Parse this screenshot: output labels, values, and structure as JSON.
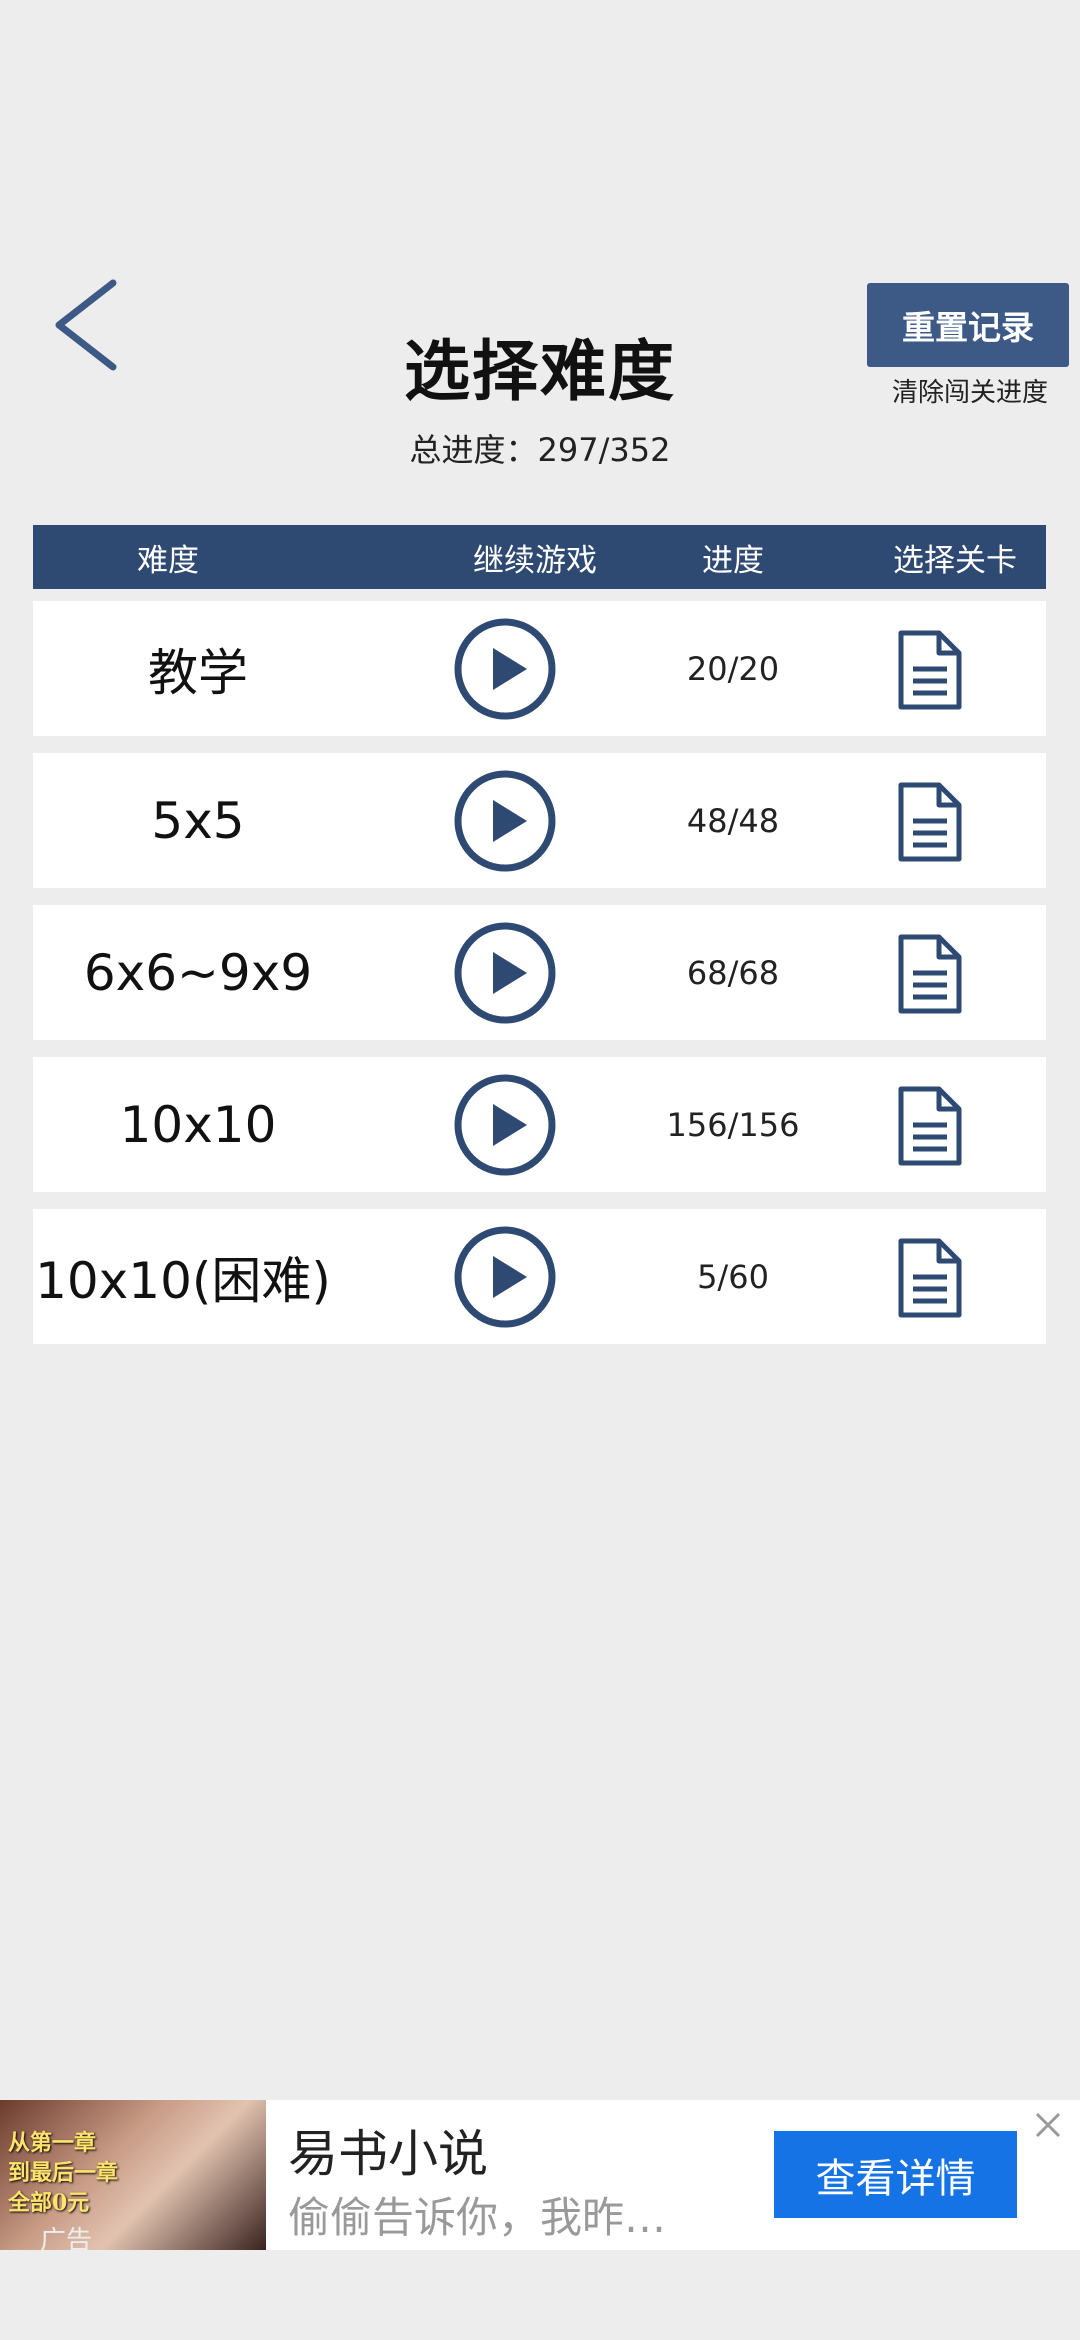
{
  "header": {
    "title": "选择难度",
    "total_progress": "总进度：297/352",
    "reset_button": "重置记录",
    "reset_note": "清除闯关进度",
    "back_icon": "chevron-left-icon"
  },
  "table": {
    "headers": [
      "难度",
      "继续游戏",
      "进度",
      "选择关卡"
    ],
    "rows": [
      {
        "name": "教学",
        "progress": "20/20"
      },
      {
        "name": "5x5",
        "progress": "48/48"
      },
      {
        "name": "6x6~9x9",
        "progress": "68/68"
      },
      {
        "name": "10x10",
        "progress": "156/156"
      },
      {
        "name": "10x10(困难)",
        "progress": "5/60"
      }
    ]
  },
  "ad": {
    "title": "易书小说",
    "subtitle": "偷偷告诉你，我昨…",
    "button": "查看详情",
    "image_text": "从第一章\n到最后一章\n全部0元",
    "label": "广告"
  },
  "colors": {
    "accent": "#2e4a72",
    "button": "#3d5a87",
    "ad_button": "#1673e6",
    "background": "#ededed"
  }
}
